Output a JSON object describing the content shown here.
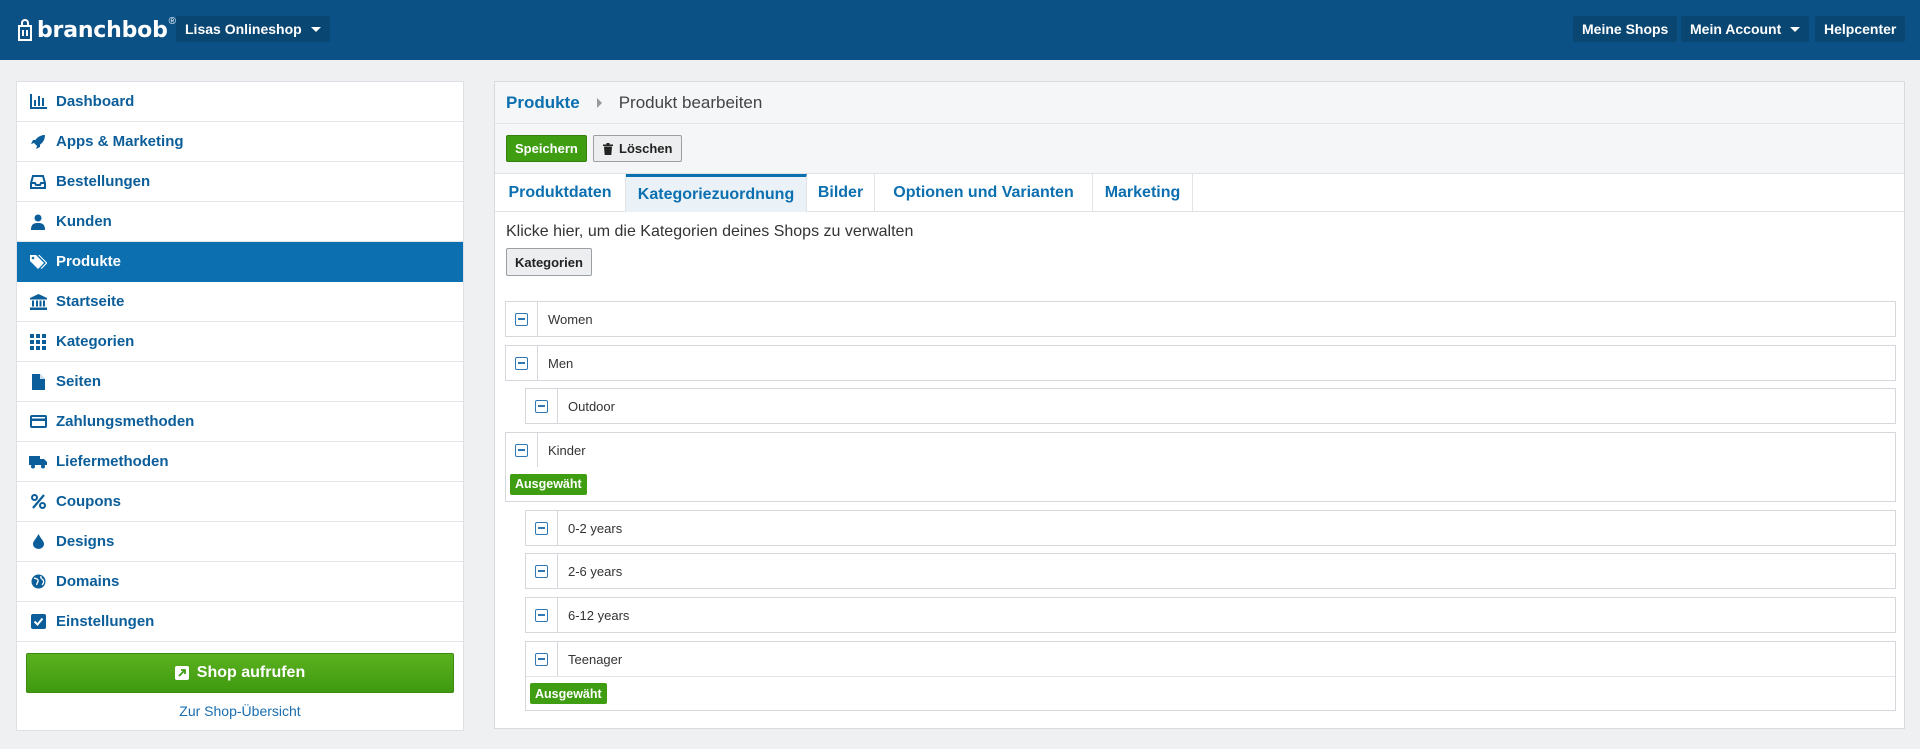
{
  "topbar": {
    "brand": "branchbob",
    "brand_mark": "®",
    "shop_selector": "Lisas Onlineshop",
    "my_shops": "Meine Shops",
    "my_account": "Mein Account",
    "help": "Helpcenter"
  },
  "sidebar": {
    "items": [
      {
        "label": "Dashboard",
        "icon": "bar-chart-icon"
      },
      {
        "label": "Apps & Marketing",
        "icon": "rocket-icon"
      },
      {
        "label": "Bestellungen",
        "icon": "inbox-icon"
      },
      {
        "label": "Kunden",
        "icon": "user-icon"
      },
      {
        "label": "Produkte",
        "icon": "tags-icon"
      },
      {
        "label": "Startseite",
        "icon": "bank-icon"
      },
      {
        "label": "Kategorien",
        "icon": "grid-icon"
      },
      {
        "label": "Seiten",
        "icon": "file-icon"
      },
      {
        "label": "Zahlungsmethoden",
        "icon": "credit-card-icon"
      },
      {
        "label": "Liefermethoden",
        "icon": "truck-icon"
      },
      {
        "label": "Coupons",
        "icon": "percent-icon"
      },
      {
        "label": "Designs",
        "icon": "droplet-icon"
      },
      {
        "label": "Domains",
        "icon": "globe-icon"
      },
      {
        "label": "Einstellungen",
        "icon": "checkbox-icon"
      }
    ],
    "active_item": "Produkte",
    "shop_button": "Shop aufrufen",
    "overview_link": "Zur Shop-Übersicht"
  },
  "breadcrumb": {
    "parent": "Produkte",
    "current": "Produkt bearbeiten"
  },
  "toolbar": {
    "save": "Speichern",
    "delete": "Löschen"
  },
  "tabs": [
    {
      "label": "Produktdaten"
    },
    {
      "label": "Kategoriezuordnung"
    },
    {
      "label": "Bilder"
    },
    {
      "label": "Optionen und Varianten"
    },
    {
      "label": "Marketing"
    }
  ],
  "active_tab": "Kategoriezuordnung",
  "categories_section": {
    "hint": "Klicke hier, um die Kategorien deines Shops zu verwalten",
    "button": "Kategorien",
    "tree": [
      {
        "name": "Women",
        "level": 0,
        "selected": false
      },
      {
        "name": "Men",
        "level": 0,
        "selected": false
      },
      {
        "name": "Outdoor",
        "level": 1,
        "selected": false
      },
      {
        "name": "Kinder",
        "level": 0,
        "selected": true
      },
      {
        "name": "0-2 years",
        "level": 1,
        "selected": false
      },
      {
        "name": "2-6 years",
        "level": 1,
        "selected": false
      },
      {
        "name": "6-12 years",
        "level": 1,
        "selected": false
      },
      {
        "name": "Teenager",
        "level": 1,
        "selected": true
      }
    ],
    "selected_badge": "Ausgewäht"
  },
  "colors": {
    "topbar": "#0b5185",
    "accent": "#0b6fb0",
    "green": "#3f9d12"
  }
}
